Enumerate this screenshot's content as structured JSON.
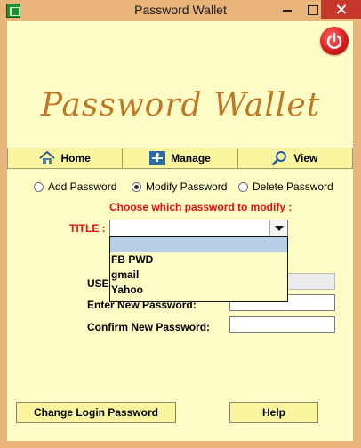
{
  "window": {
    "title": "Password Wallet"
  },
  "brand": {
    "logo_text": "Password Wallet",
    "power_icon": "power-icon"
  },
  "nav": {
    "items": [
      {
        "label": "Home",
        "icon": "home-icon"
      },
      {
        "label": "Manage",
        "icon": "manage-icon"
      },
      {
        "label": "View",
        "icon": "search-icon"
      }
    ]
  },
  "mode": {
    "options": [
      {
        "label": "Add Password",
        "checked": false
      },
      {
        "label": "Modify Password",
        "checked": true
      },
      {
        "label": "Delete Password",
        "checked": false
      }
    ]
  },
  "form": {
    "instruction": "Choose which password to modify :",
    "title_label": "TITLE :",
    "title_value": "",
    "dropdown_options": [
      "",
      "FB PWD",
      "gmail",
      "Yahoo"
    ],
    "username_label_visible": "USE",
    "new_password_label": "Enter New Password:",
    "confirm_password_label": "Confirm New Password:"
  },
  "footer": {
    "change_login_label": "Change Login Password",
    "help_label": "Help"
  },
  "colors": {
    "frame": "#e9b47a",
    "panel": "#fefdc5",
    "button_bg": "#fbf59f",
    "accent_red": "#e01010",
    "logo_gold": "#c07828",
    "selected_option": "#b8cfe6"
  }
}
